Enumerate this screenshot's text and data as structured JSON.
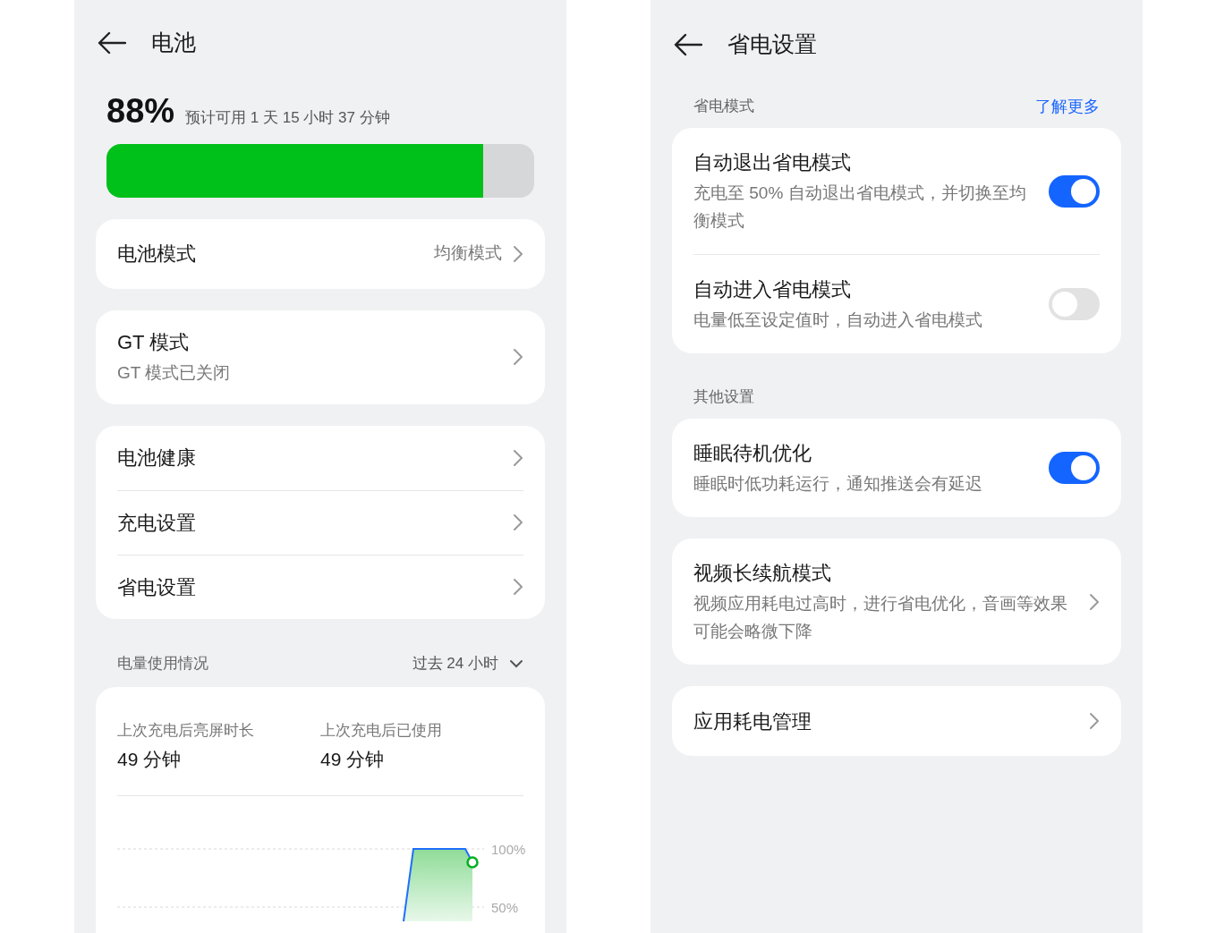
{
  "left_screen": {
    "title": "电池",
    "battery": {
      "percent": "88%",
      "estimate": "预计可用 1 天 15 小时 37 分钟",
      "level": 0.88
    },
    "menu_groups": [
      [
        {
          "label": "电池模式",
          "value": "均衡模式"
        }
      ],
      [
        {
          "label": "GT 模式",
          "subtitle": "GT 模式已关闭"
        }
      ],
      [
        {
          "label": "电池健康"
        },
        {
          "label": "充电设置"
        },
        {
          "label": "省电设置"
        }
      ]
    ],
    "usage": {
      "title": "电量使用情况",
      "range": "过去 24 小时",
      "stats": [
        {
          "label": "上次充电后亮屏时长",
          "value": "49 分钟"
        },
        {
          "label": "上次充电后已使用",
          "value": "49 分钟"
        }
      ],
      "chart_ticks": [
        "100%",
        "50%"
      ]
    }
  },
  "right_screen": {
    "title": "省电设置",
    "sections": [
      {
        "title": "省电模式",
        "link": "了解更多",
        "cards": [
          [
            {
              "kind": "toggle",
              "title": "自动退出省电模式",
              "description": "充电至 50% 自动退出省电模式，并切换至均衡模式",
              "on": true
            },
            {
              "kind": "toggle",
              "title": "自动进入省电模式",
              "description": "电量低至设定值时，自动进入省电模式",
              "on": false
            }
          ]
        ]
      },
      {
        "title": "其他设置",
        "cards": [
          [
            {
              "kind": "toggle",
              "title": "睡眠待机优化",
              "description": "睡眠时低功耗运行，通知推送会有延迟",
              "on": true
            }
          ],
          [
            {
              "kind": "link",
              "title": "视频长续航模式",
              "description": "视频应用耗电过高时，进行省电优化，音画等效果可能会略微下降"
            }
          ],
          [
            {
              "kind": "link",
              "title": "应用耗电管理"
            }
          ]
        ]
      }
    ]
  }
}
